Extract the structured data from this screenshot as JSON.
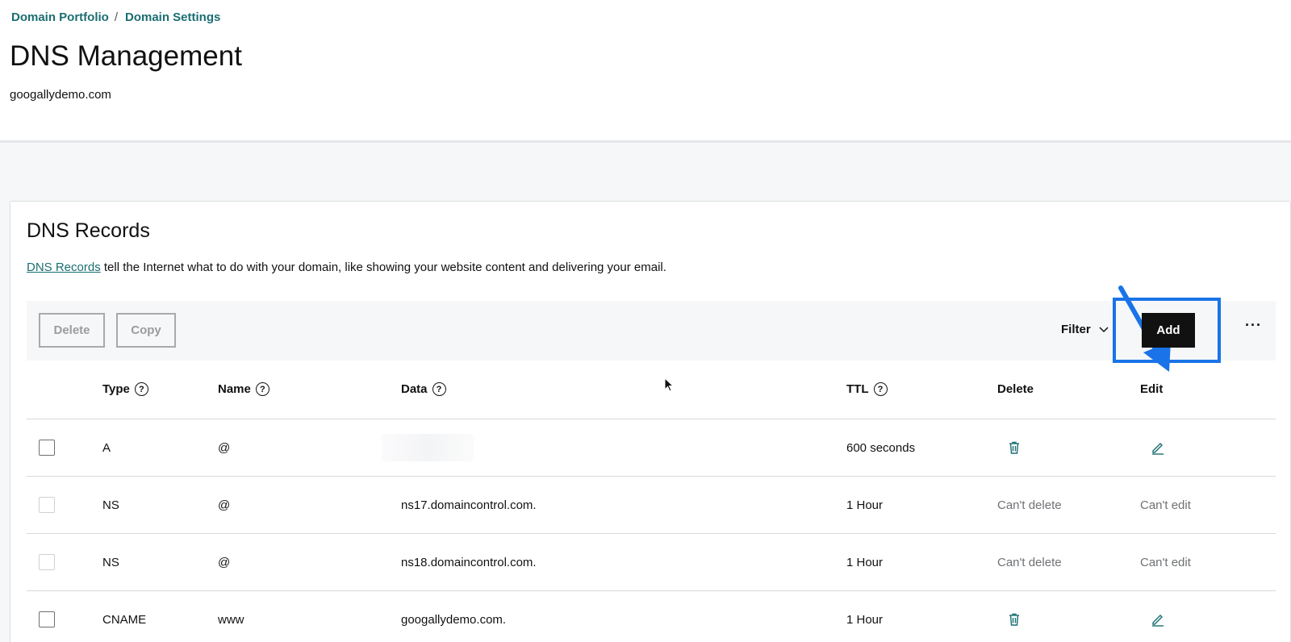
{
  "breadcrumb": {
    "items": [
      "Domain Portfolio",
      "Domain Settings"
    ],
    "separator": "/"
  },
  "header": {
    "title": "DNS Management",
    "domain": "googallydemo.com"
  },
  "card": {
    "title": "DNS Records",
    "description_link": "DNS Records",
    "description_text": " tell the Internet what to do with your domain, like showing your website content and delivering your email."
  },
  "toolbar": {
    "delete_label": "Delete",
    "copy_label": "Copy",
    "filter_label": "Filter",
    "add_label": "Add",
    "more_label": "···"
  },
  "table": {
    "headers": {
      "type": "Type",
      "name": "Name",
      "data": "Data",
      "ttl": "TTL",
      "delete": "Delete",
      "edit": "Edit"
    },
    "rows": [
      {
        "type": "A",
        "name": "@",
        "data": "",
        "ttl": "600 seconds",
        "delete": "trash-icon",
        "edit": "pencil-icon",
        "editable": true
      },
      {
        "type": "NS",
        "name": "@",
        "data": "ns17.domaincontrol.com.",
        "ttl": "1 Hour",
        "delete": "Can't delete",
        "edit": "Can't edit",
        "editable": false
      },
      {
        "type": "NS",
        "name": "@",
        "data": "ns18.domaincontrol.com.",
        "ttl": "1 Hour",
        "delete": "Can't delete",
        "edit": "Can't edit",
        "editable": false
      },
      {
        "type": "CNAME",
        "name": "www",
        "data": "googallydemo.com.",
        "ttl": "1 Hour",
        "delete": "trash-icon",
        "edit": "pencil-icon",
        "editable": true
      }
    ]
  },
  "colors": {
    "accent": "#1b6e72",
    "highlight": "#1a73e8",
    "primary_button": "#111111"
  }
}
